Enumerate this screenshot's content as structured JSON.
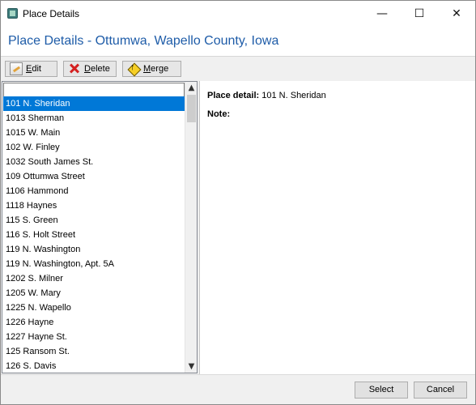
{
  "window": {
    "title": "Place Details",
    "controls": {
      "minimize": "—",
      "maximize": "☐",
      "close": "✕"
    }
  },
  "header": {
    "title": "Place Details - Ottumwa, Wapello County, Iowa"
  },
  "toolbar": {
    "edit_label": "Edit",
    "delete_label": "Delete",
    "merge_label": "Merge"
  },
  "list": {
    "search_value": "",
    "selected_index": 0,
    "items": [
      "101 N. Sheridan",
      "1013 Sherman",
      "1015 W. Main",
      "102 W. Finley",
      "1032 South James St.",
      "109 Ottumwa Street",
      "1106 Hammond",
      "1118 Haynes",
      "115 S. Green",
      "116 S. Holt Street",
      "119 N. Washington",
      "119 N. Washington, Apt. 5A",
      "1202 S. Milner",
      "1205 W. Mary",
      "1225 N. Wapello",
      "1226 Hayne",
      "1227 Hayne St.",
      "125 Ransom St.",
      "126 S. Davis"
    ],
    "scroll_up": "▲",
    "scroll_down": "▼"
  },
  "detail": {
    "place_label": "Place detail:",
    "place_value": "101 N. Sheridan",
    "note_label": "Note:",
    "note_value": ""
  },
  "footer": {
    "select_label": "Select",
    "cancel_label": "Cancel"
  },
  "colors": {
    "title_blue": "#1e5ca8",
    "selection": "#0078d7"
  },
  "icons": {
    "app": "place-details-app-icon",
    "edit": "pencil-icon",
    "delete": "red-x-icon",
    "merge": "yellow-diamond-arrow-icon"
  }
}
